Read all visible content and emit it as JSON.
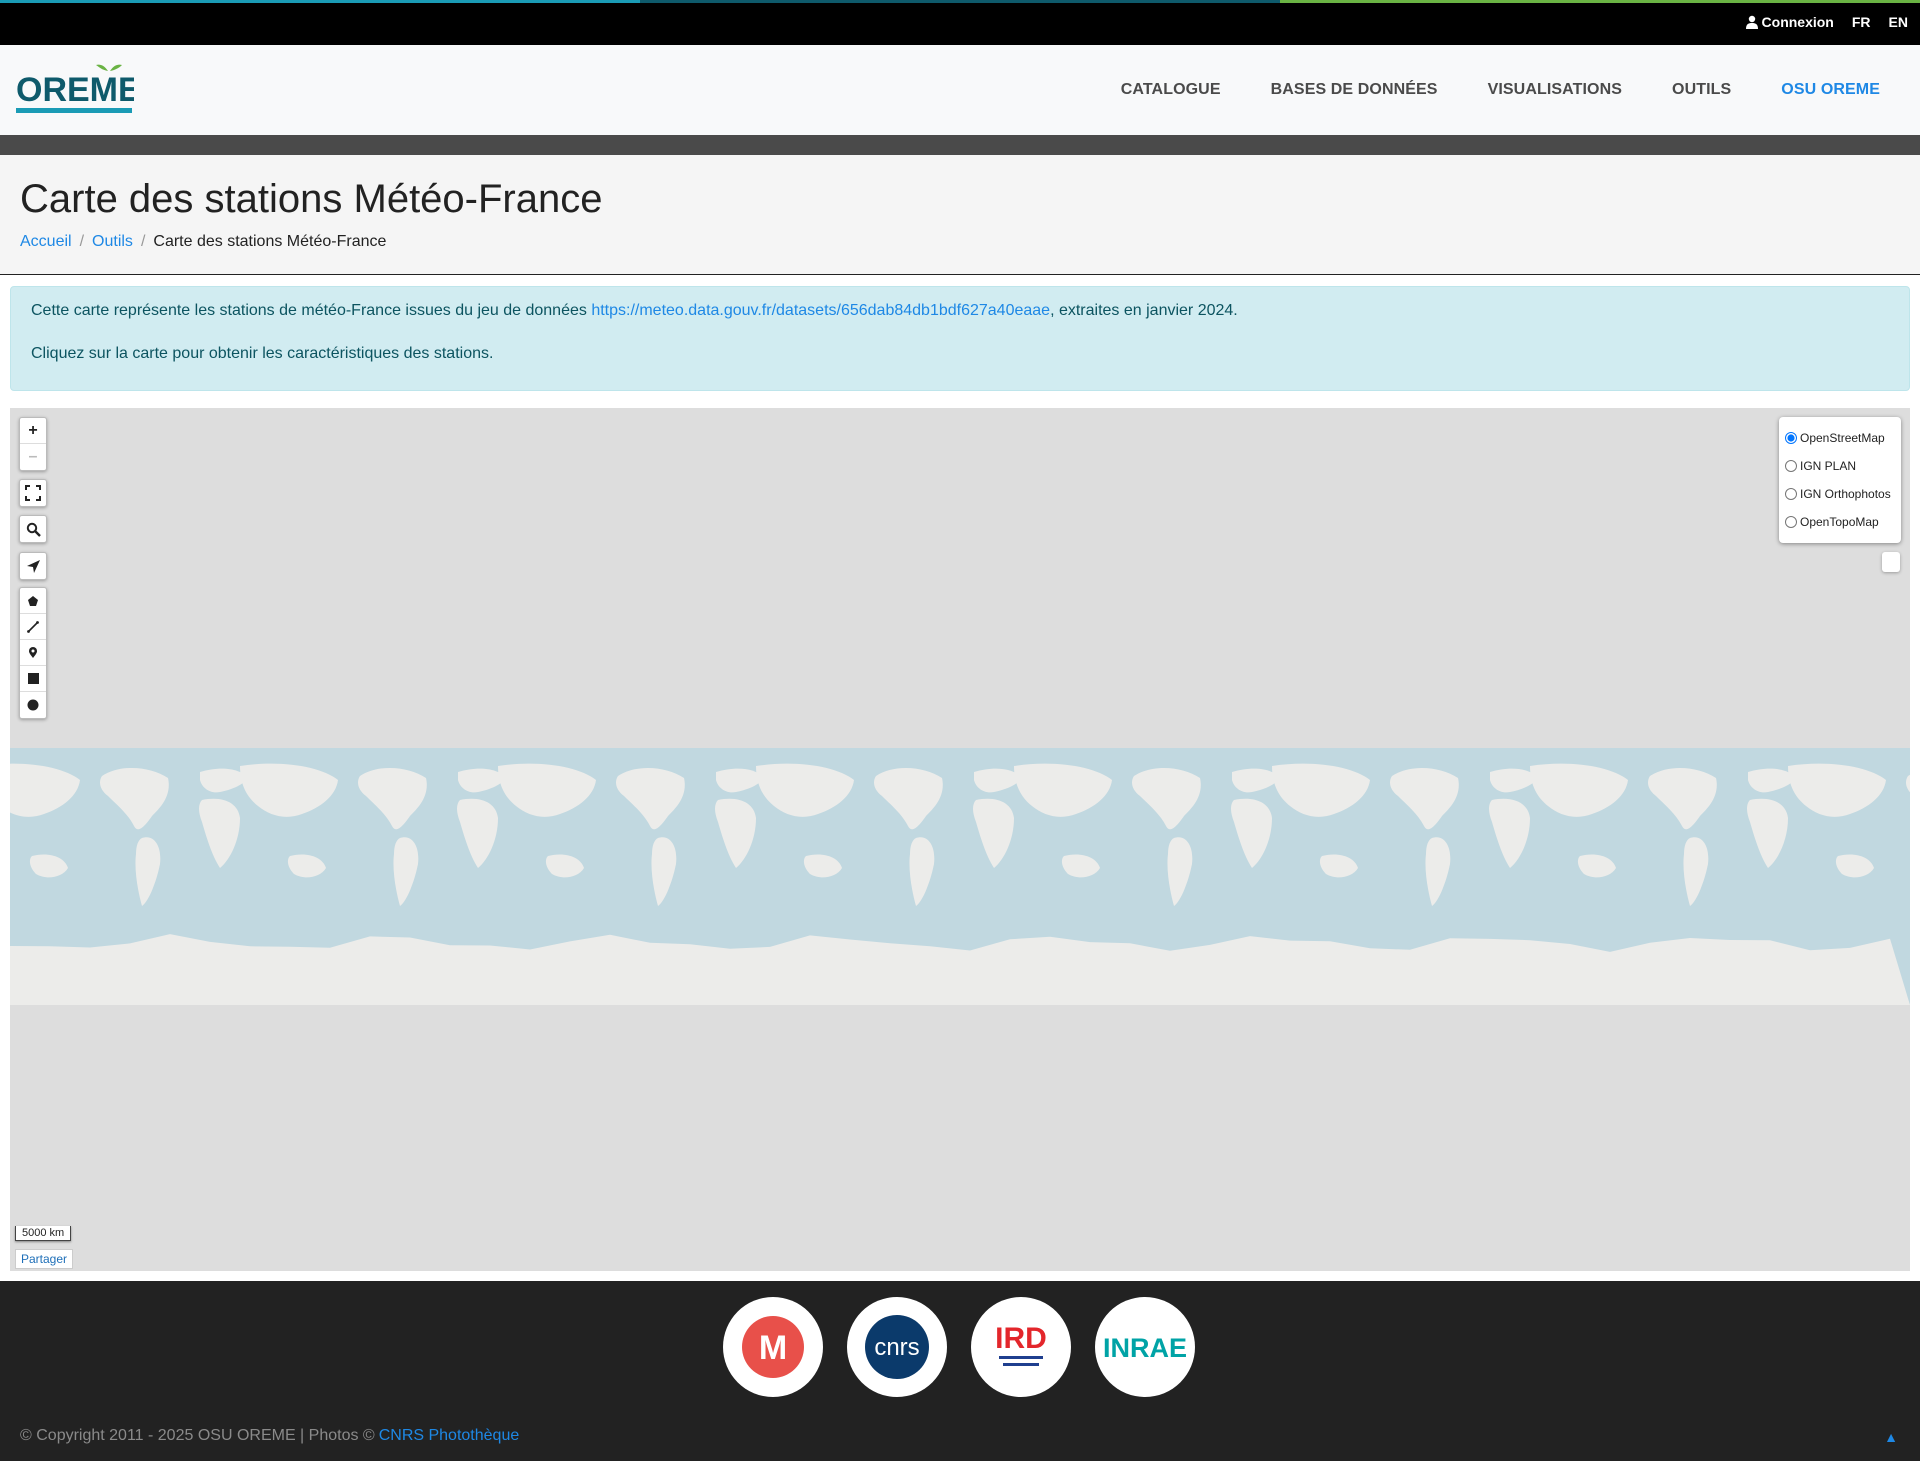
{
  "topbar": {
    "stripe_colors": [
      "#1a9bb5",
      "#0e5a6b",
      "#6ab344"
    ],
    "login_label": "Connexion",
    "lang_fr": "FR",
    "lang_en": "EN"
  },
  "header": {
    "logo_text": "OREME",
    "nav": [
      {
        "label": "CATALOGUE",
        "active": false
      },
      {
        "label": "BASES DE DONNÉES",
        "active": false
      },
      {
        "label": "VISUALISATIONS",
        "active": false
      },
      {
        "label": "OUTILS",
        "active": false
      },
      {
        "label": "OSU OREME",
        "active": true
      }
    ]
  },
  "page": {
    "title": "Carte des stations Météo-France",
    "breadcrumb": {
      "home": "Accueil",
      "sep": "/",
      "tools": "Outils",
      "current": "Carte des stations Météo-France"
    }
  },
  "alert": {
    "text_before": "Cette carte représente les stations de météo-France issues du jeu de données ",
    "link": "https://meteo.data.gouv.fr/datasets/656dab84db1bdf627a40eaae",
    "text_after": ", extraites en janvier 2024.",
    "line2": "Cliquez sur la carte pour obtenir les caractéristiques des stations."
  },
  "map": {
    "zoom_in": "+",
    "zoom_out": "–",
    "layers": [
      {
        "label": "OpenStreetMap",
        "checked": true
      },
      {
        "label": "IGN PLAN",
        "checked": false
      },
      {
        "label": "IGN Orthophotos",
        "checked": false
      },
      {
        "label": "OpenTopoMap",
        "checked": false
      }
    ],
    "scale_label": "5000 km",
    "share_label": "Partager",
    "ocean_color": "#c1d8e0",
    "land_color": "#ececea"
  },
  "footer": {
    "partners": [
      {
        "name": "Université de Montpellier",
        "text": "M"
      },
      {
        "name": "CNRS",
        "text": "cnrs"
      },
      {
        "name": "IRD",
        "text": "IRD"
      },
      {
        "name": "INRAE",
        "text": "INRAE"
      }
    ],
    "copyright": "© Copyright 2011 - 2025 OSU OREME | Photos ©",
    "photo_credit": "CNRS Photothèque",
    "to_top": "▲"
  }
}
